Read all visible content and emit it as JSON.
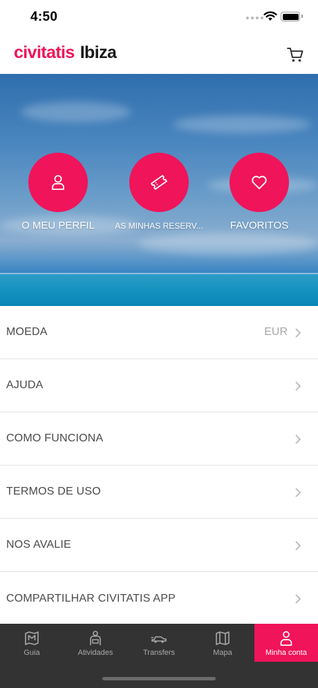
{
  "status_bar": {
    "time": "4:50"
  },
  "header": {
    "brand": "civitatis",
    "city": "Ibiza"
  },
  "hero": {
    "buttons": [
      {
        "label": "O MEU PERFIL",
        "icon": "person-icon"
      },
      {
        "label": "AS MINHAS RESERV...",
        "icon": "ticket-icon"
      },
      {
        "label": "FAVORITOS",
        "icon": "heart-icon"
      }
    ]
  },
  "menu": [
    {
      "label": "MOEDA",
      "value": "EUR"
    },
    {
      "label": "AJUDA"
    },
    {
      "label": "COMO FUNCIONA"
    },
    {
      "label": "TERMOS DE USO"
    },
    {
      "label": "NOS AVALIE"
    },
    {
      "label": "COMPARTILHAR CIVITATIS APP"
    }
  ],
  "tabs": [
    {
      "label": "Guia",
      "icon": "map-guide-icon"
    },
    {
      "label": "Atividades",
      "icon": "activities-icon"
    },
    {
      "label": "Transfers",
      "icon": "car-icon"
    },
    {
      "label": "Mapa",
      "icon": "map-icon"
    },
    {
      "label": "Minha conta",
      "icon": "account-icon",
      "active": true
    }
  ],
  "colors": {
    "accent": "#f0145a",
    "tabbar": "#333333",
    "text": "#4a4a4a",
    "muted": "#a6a6a6"
  }
}
